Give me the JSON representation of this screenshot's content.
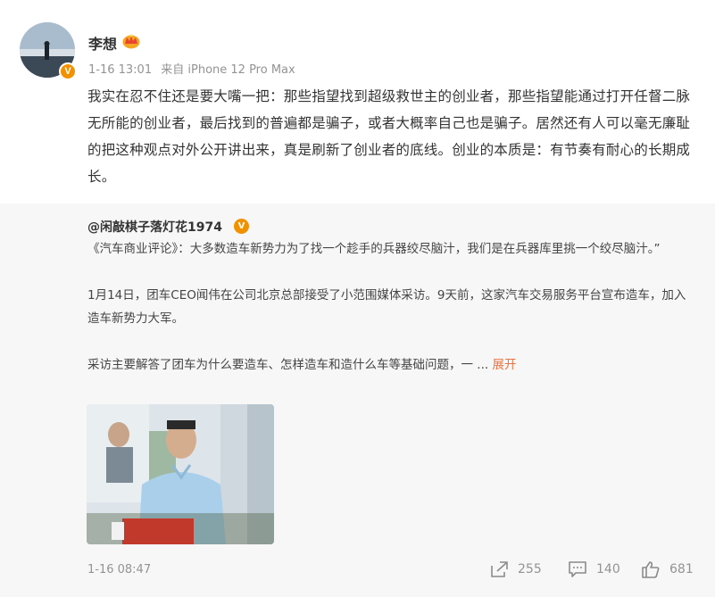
{
  "post": {
    "author": "李想",
    "vip_icon": "crown-icon",
    "verified_badge": "V",
    "time": "1-16 13:01",
    "source": "来自 iPhone 12 Pro Max",
    "text": "我实在忍不住还是要大嘴一把：那些指望找到超级救世主的创业者，那些指望能通过打开任督二脉无所能的创业者，最后找到的普遍都是骗子，或者大概率自己也是骗子。居然还有人可以毫无廉耻的把这种观点对外公开讲出来，真是刷新了创业者的底线。创业的本质是：有节奏有耐心的长期成长。"
  },
  "repost": {
    "author": "@闲敲棋子落灯花1974",
    "verified_badge": "V",
    "paragraphs": [
      "《汽车商业评论》：大多数造车新势力为了找一个趁手的兵器绞尽脑汁，我们是在兵器库里挑一个绞尽脑汁。”",
      "1月14日，团车CEO闻伟在公司北京总部接受了小范围媒体采访。9天前，这家汽车交易服务平台宣布造车，加入造车新势力大军。"
    ],
    "truncated_text": "采访主要解答了团车为什么要造车、怎样造车和造什么车等基础问题，一 ...",
    "expand_label": "展开",
    "time": "1-16 08:47",
    "actions": {
      "share_count": "255",
      "comment_count": "140",
      "like_count": "681"
    }
  },
  "colors": {
    "accent_orange": "#eb7340",
    "badge_orange": "#f29100",
    "meta_gray": "#939393",
    "repost_bg": "#f7f7f7"
  }
}
